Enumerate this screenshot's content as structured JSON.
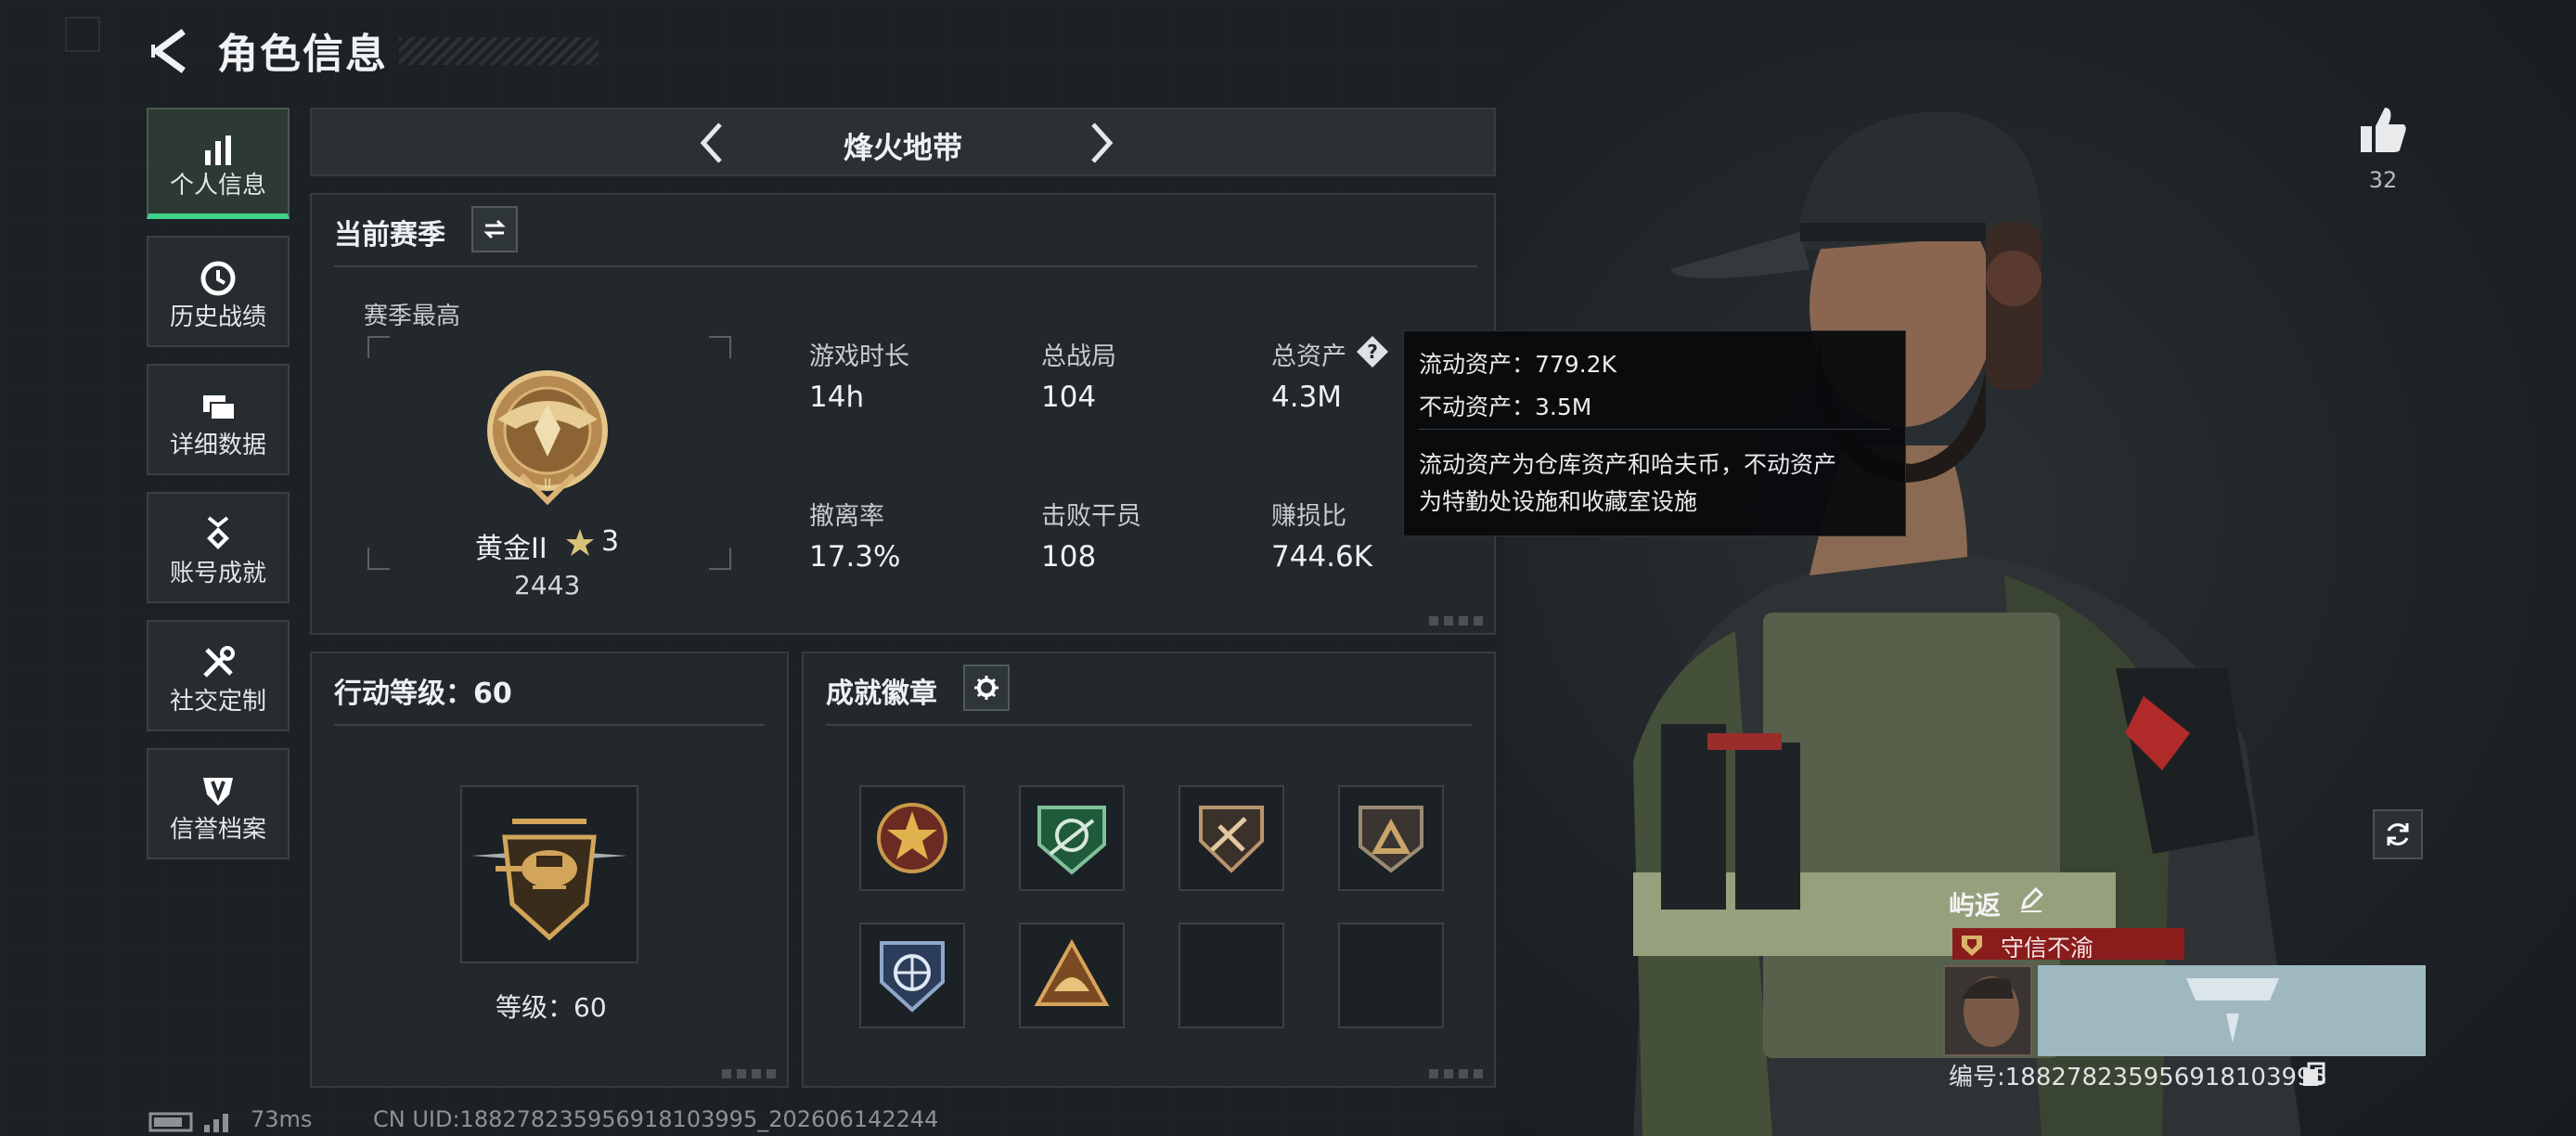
{
  "header": {
    "title": "角色信息"
  },
  "sidebar": {
    "items": [
      {
        "label": "个人信息",
        "icon": "bar-chart-icon",
        "active": true
      },
      {
        "label": "历史战绩",
        "icon": "history-clock-icon",
        "active": false
      },
      {
        "label": "详细数据",
        "icon": "folder-stack-icon",
        "active": false
      },
      {
        "label": "账号成就",
        "icon": "medal-icon",
        "active": false
      },
      {
        "label": "社交定制",
        "icon": "wrench-cross-icon",
        "active": false
      },
      {
        "label": "信誉档案",
        "icon": "shield-emblem-icon",
        "active": false
      }
    ]
  },
  "mode": {
    "title": "烽火地带"
  },
  "season": {
    "title": "当前赛季",
    "best_label": "赛季最高",
    "rank_name": "黄金II",
    "rank_stars": "3",
    "rank_score": "2443",
    "stats": [
      {
        "label": "游戏时长",
        "value": "14h"
      },
      {
        "label": "总战局",
        "value": "104"
      },
      {
        "label": "总资产",
        "value": "4.3M"
      },
      {
        "label": "撤离率",
        "value": "17.3%"
      },
      {
        "label": "击败干员",
        "value": "108"
      },
      {
        "label": "赚损比",
        "value": "744.6K"
      }
    ]
  },
  "tooltip": {
    "line1": "流动资产：779.2K",
    "line2": "不动资产：3.5M",
    "desc1": "流动资产为仓库资产和哈夫币，不动资产",
    "desc2": "为特勤处设施和收藏室设施"
  },
  "action_level": {
    "title": "行动等级：60",
    "level_label": "等级：60"
  },
  "badges": {
    "title": "成就徽章",
    "slots": [
      "star-badge",
      "target-badge",
      "weapon-badge",
      "triangle-badge",
      "globe-badge",
      "helmet-badge",
      "empty",
      "empty"
    ]
  },
  "profile": {
    "likes": "32",
    "name": "屿返",
    "title_badge": "守信不渝",
    "uid_line": "编号:1882782359569181039​95"
  },
  "footer": {
    "ping": "73ms",
    "cn_uid": "CN UID:1882782359569181039​95_202606142244"
  },
  "colors": {
    "accent_green": "#3fd28a",
    "title_red": "#8a1c1c",
    "panel_bg": "#22282c"
  }
}
